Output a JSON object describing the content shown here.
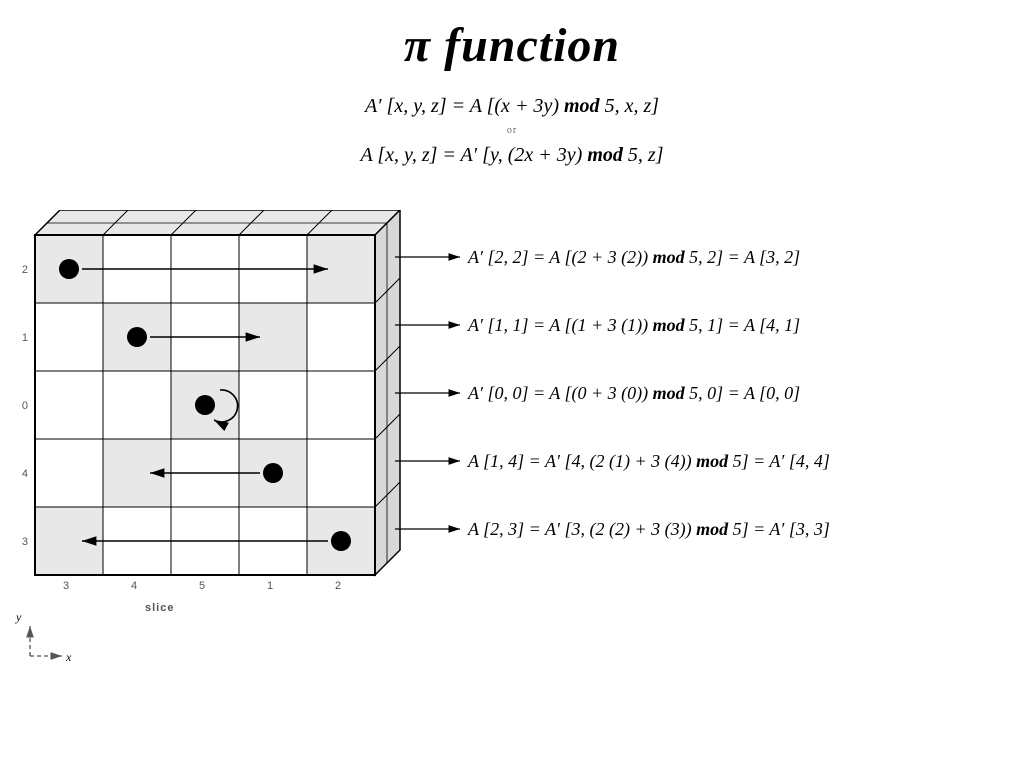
{
  "title": "π  function",
  "formulas": {
    "line1": "A′ [x, y, z] = A [(x + 3y) mod 5, x, z]",
    "or": "or",
    "line2": "A [x, y, z] = A′ [y, (2x + 3y) mod 5, z]"
  },
  "grid": {
    "row_labels": [
      "2",
      "1",
      "0",
      "4",
      "3"
    ],
    "col_labels": [
      "3",
      "4",
      "5",
      "1",
      "2"
    ],
    "slice_label": "slice",
    "highlighted_cells": [
      {
        "row": 0,
        "col": 0
      },
      {
        "row": 0,
        "col": 4
      },
      {
        "row": 1,
        "col": 1
      },
      {
        "row": 1,
        "col": 3
      },
      {
        "row": 2,
        "col": 2
      },
      {
        "row": 3,
        "col": 1
      },
      {
        "row": 3,
        "col": 3
      },
      {
        "row": 4,
        "col": 0
      },
      {
        "row": 4,
        "col": 4
      }
    ],
    "dots": [
      {
        "row": 0,
        "col": 0
      },
      {
        "row": 1,
        "col": 1
      },
      {
        "row": 2,
        "col": 2
      },
      {
        "row": 3,
        "col": 3
      },
      {
        "row": 4,
        "col": 4
      }
    ]
  },
  "equations": [
    "A′ [2, 2] = A [(2 + 3 (2)) mod 5, 2] = A [3, 2]",
    "A′ [1, 1] = A [(1 + 3 (1)) mod 5, 1] = A [4, 1]",
    "A′ [0, 0] = A [(0 + 3 (0)) mod 5, 0] = A [0, 0]",
    "A [1, 4] = A′ [4, (2 (1) + 3 (4)) mod 5] = A′ [4, 4]",
    "A [2, 3] = A′ [3, (2 (2) + 3 (3)) mod 5] = A′ [3, 3]"
  ],
  "axes": {
    "x": "x",
    "y": "y"
  }
}
